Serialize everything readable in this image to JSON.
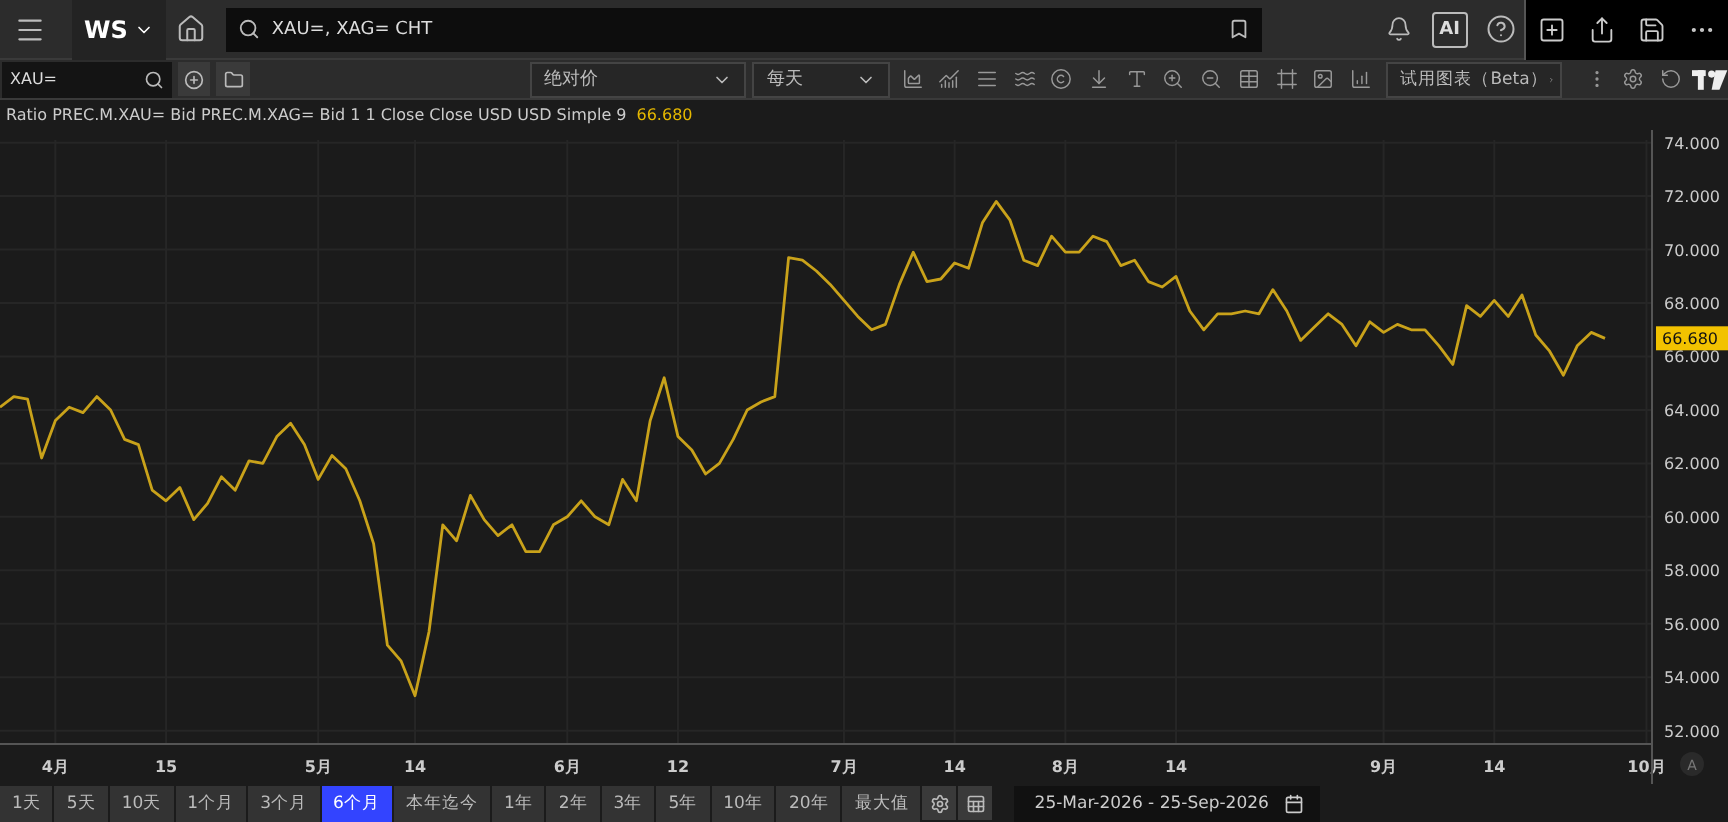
{
  "top_bar": {
    "brand": "WS",
    "search_value": "XAU=, XAG= CHT",
    "ai_button": "AI"
  },
  "toolbar": {
    "symbol_value": "XAU=",
    "price_type": "绝对价",
    "interval": "每天",
    "beta_button": "试用图表（Beta）"
  },
  "legend": {
    "last_value": "66.680"
  },
  "chart": {
    "price_tag": "66.680",
    "axis_badge": "A",
    "chart_data": {
      "type": "line",
      "grid": true,
      "ylim": [
        51.5,
        74.1
      ],
      "categories": [
        null,
        null,
        null,
        null,
        "4月",
        null,
        null,
        null,
        null,
        null,
        null,
        null,
        "15",
        null,
        null,
        null,
        null,
        null,
        null,
        null,
        null,
        null,
        null,
        "5月",
        null,
        null,
        null,
        null,
        null,
        null,
        "14",
        null,
        null,
        null,
        null,
        null,
        null,
        null,
        null,
        null,
        null,
        "6月",
        null,
        null,
        null,
        null,
        null,
        null,
        null,
        "12",
        null,
        null,
        null,
        null,
        null,
        null,
        null,
        null,
        null,
        null,
        null,
        "7月",
        null,
        null,
        null,
        null,
        null,
        null,
        null,
        "14",
        null,
        null,
        null,
        null,
        null,
        null,
        null,
        "8月",
        null,
        null,
        null,
        null,
        null,
        null,
        null,
        "14",
        null,
        null,
        null,
        null,
        null,
        null,
        null,
        null,
        null,
        null,
        null,
        null,
        null,
        null,
        "9月",
        null,
        null,
        null,
        null,
        null,
        null,
        null,
        "14",
        null,
        null,
        null,
        null,
        null,
        null,
        null,
        null,
        null,
        null,
        "10月"
      ],
      "yticks": [
        {
          "value": 52,
          "label": "52.000"
        },
        {
          "value": 54,
          "label": "54.000"
        },
        {
          "value": 56,
          "label": "56.000"
        },
        {
          "value": 58,
          "label": "58.000"
        },
        {
          "value": 60,
          "label": "60.000"
        },
        {
          "value": 62,
          "label": "62.000"
        },
        {
          "value": 64,
          "label": "64.000"
        },
        {
          "value": 66,
          "label": "66.000"
        },
        {
          "value": 68,
          "label": "68.000"
        },
        {
          "value": 70,
          "label": "70.000"
        },
        {
          "value": 72,
          "label": "72.000"
        },
        {
          "value": 74,
          "label": "74.000"
        }
      ],
      "series": [
        {
          "name": "Ratio PREC.M.XAU= Bid PREC.M.XAG= Bid 1 1 Close Close USD USD Simple 9",
          "color": "#c9a21a",
          "values": [
            64.1,
            64.5,
            64.4,
            62.2,
            63.6,
            64.1,
            63.9,
            64.5,
            64.0,
            62.9,
            62.7,
            61.0,
            60.6,
            61.1,
            59.9,
            60.5,
            61.5,
            61.0,
            62.1,
            62.0,
            63.0,
            63.5,
            62.7,
            61.4,
            62.3,
            61.8,
            60.6,
            59.0,
            55.2,
            54.6,
            53.3,
            55.7,
            59.7,
            59.1,
            60.8,
            59.9,
            59.3,
            59.7,
            58.7,
            58.7,
            59.7,
            60.0,
            60.6,
            60.0,
            59.7,
            61.4,
            60.6,
            63.6,
            65.2,
            63.0,
            62.5,
            61.6,
            62.0,
            62.9,
            64.0,
            64.3,
            64.5,
            69.7,
            69.6,
            69.2,
            68.7,
            68.1,
            67.5,
            67.0,
            67.2,
            68.7,
            69.9,
            68.8,
            68.9,
            69.5,
            69.3,
            71.0,
            71.8,
            71.1,
            69.6,
            69.4,
            70.5,
            69.9,
            69.9,
            70.5,
            70.3,
            69.4,
            69.6,
            68.8,
            68.6,
            69.0,
            67.7,
            67.0,
            67.6,
            67.6,
            67.7,
            67.6,
            68.5,
            67.7,
            66.6,
            67.1,
            67.6,
            67.2,
            66.4,
            67.3,
            66.9,
            67.2,
            67.0,
            67.0,
            66.4,
            65.7,
            67.9,
            67.5,
            68.1,
            67.5,
            68.3,
            66.8,
            66.2,
            65.3,
            66.4,
            66.9,
            66.68,
            null,
            null,
            null
          ]
        }
      ]
    }
  },
  "periods": [
    {
      "label": "1天",
      "selected": false
    },
    {
      "label": "5天",
      "selected": false
    },
    {
      "label": "10天",
      "selected": false
    },
    {
      "label": "1个月",
      "selected": false
    },
    {
      "label": "3个月",
      "selected": false
    },
    {
      "label": "6个月",
      "selected": true
    },
    {
      "label": "本年迄今",
      "selected": false
    },
    {
      "label": "1年",
      "selected": false
    },
    {
      "label": "2年",
      "selected": false
    },
    {
      "label": "3年",
      "selected": false
    },
    {
      "label": "5年",
      "selected": false
    },
    {
      "label": "10年",
      "selected": false
    },
    {
      "label": "20年",
      "selected": false
    },
    {
      "label": "最大值",
      "selected": false
    }
  ],
  "date_range": "25-Mar-2026 - 25-Sep-2026"
}
